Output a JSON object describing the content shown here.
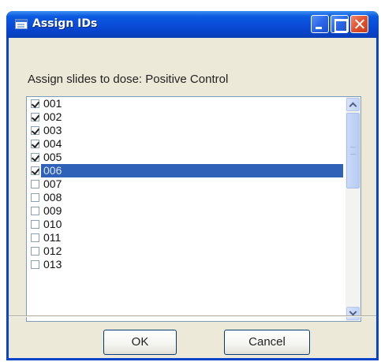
{
  "window": {
    "title": "Assign IDs"
  },
  "dialog": {
    "prompt": "Assign slides to dose: Positive Control",
    "ok_label": "OK",
    "cancel_label": "Cancel"
  },
  "list": {
    "selected_index": 5,
    "items": [
      {
        "label": "001",
        "checked": true
      },
      {
        "label": "002",
        "checked": true
      },
      {
        "label": "003",
        "checked": true
      },
      {
        "label": "004",
        "checked": true
      },
      {
        "label": "005",
        "checked": true
      },
      {
        "label": "006",
        "checked": true
      },
      {
        "label": "007",
        "checked": false
      },
      {
        "label": "008",
        "checked": false
      },
      {
        "label": "009",
        "checked": false
      },
      {
        "label": "010",
        "checked": false
      },
      {
        "label": "011",
        "checked": false
      },
      {
        "label": "012",
        "checked": false
      },
      {
        "label": "013",
        "checked": false
      }
    ]
  },
  "colors": {
    "titlebar": "#0a4bd8",
    "selection": "#2f61b8",
    "dialog_face": "#ece9d8"
  },
  "icons": {
    "app": "window-icon",
    "minimize": "minimize-icon",
    "maximize": "maximize-icon",
    "close": "close-icon",
    "scroll_up": "chevron-up-icon",
    "scroll_down": "chevron-down-icon"
  }
}
